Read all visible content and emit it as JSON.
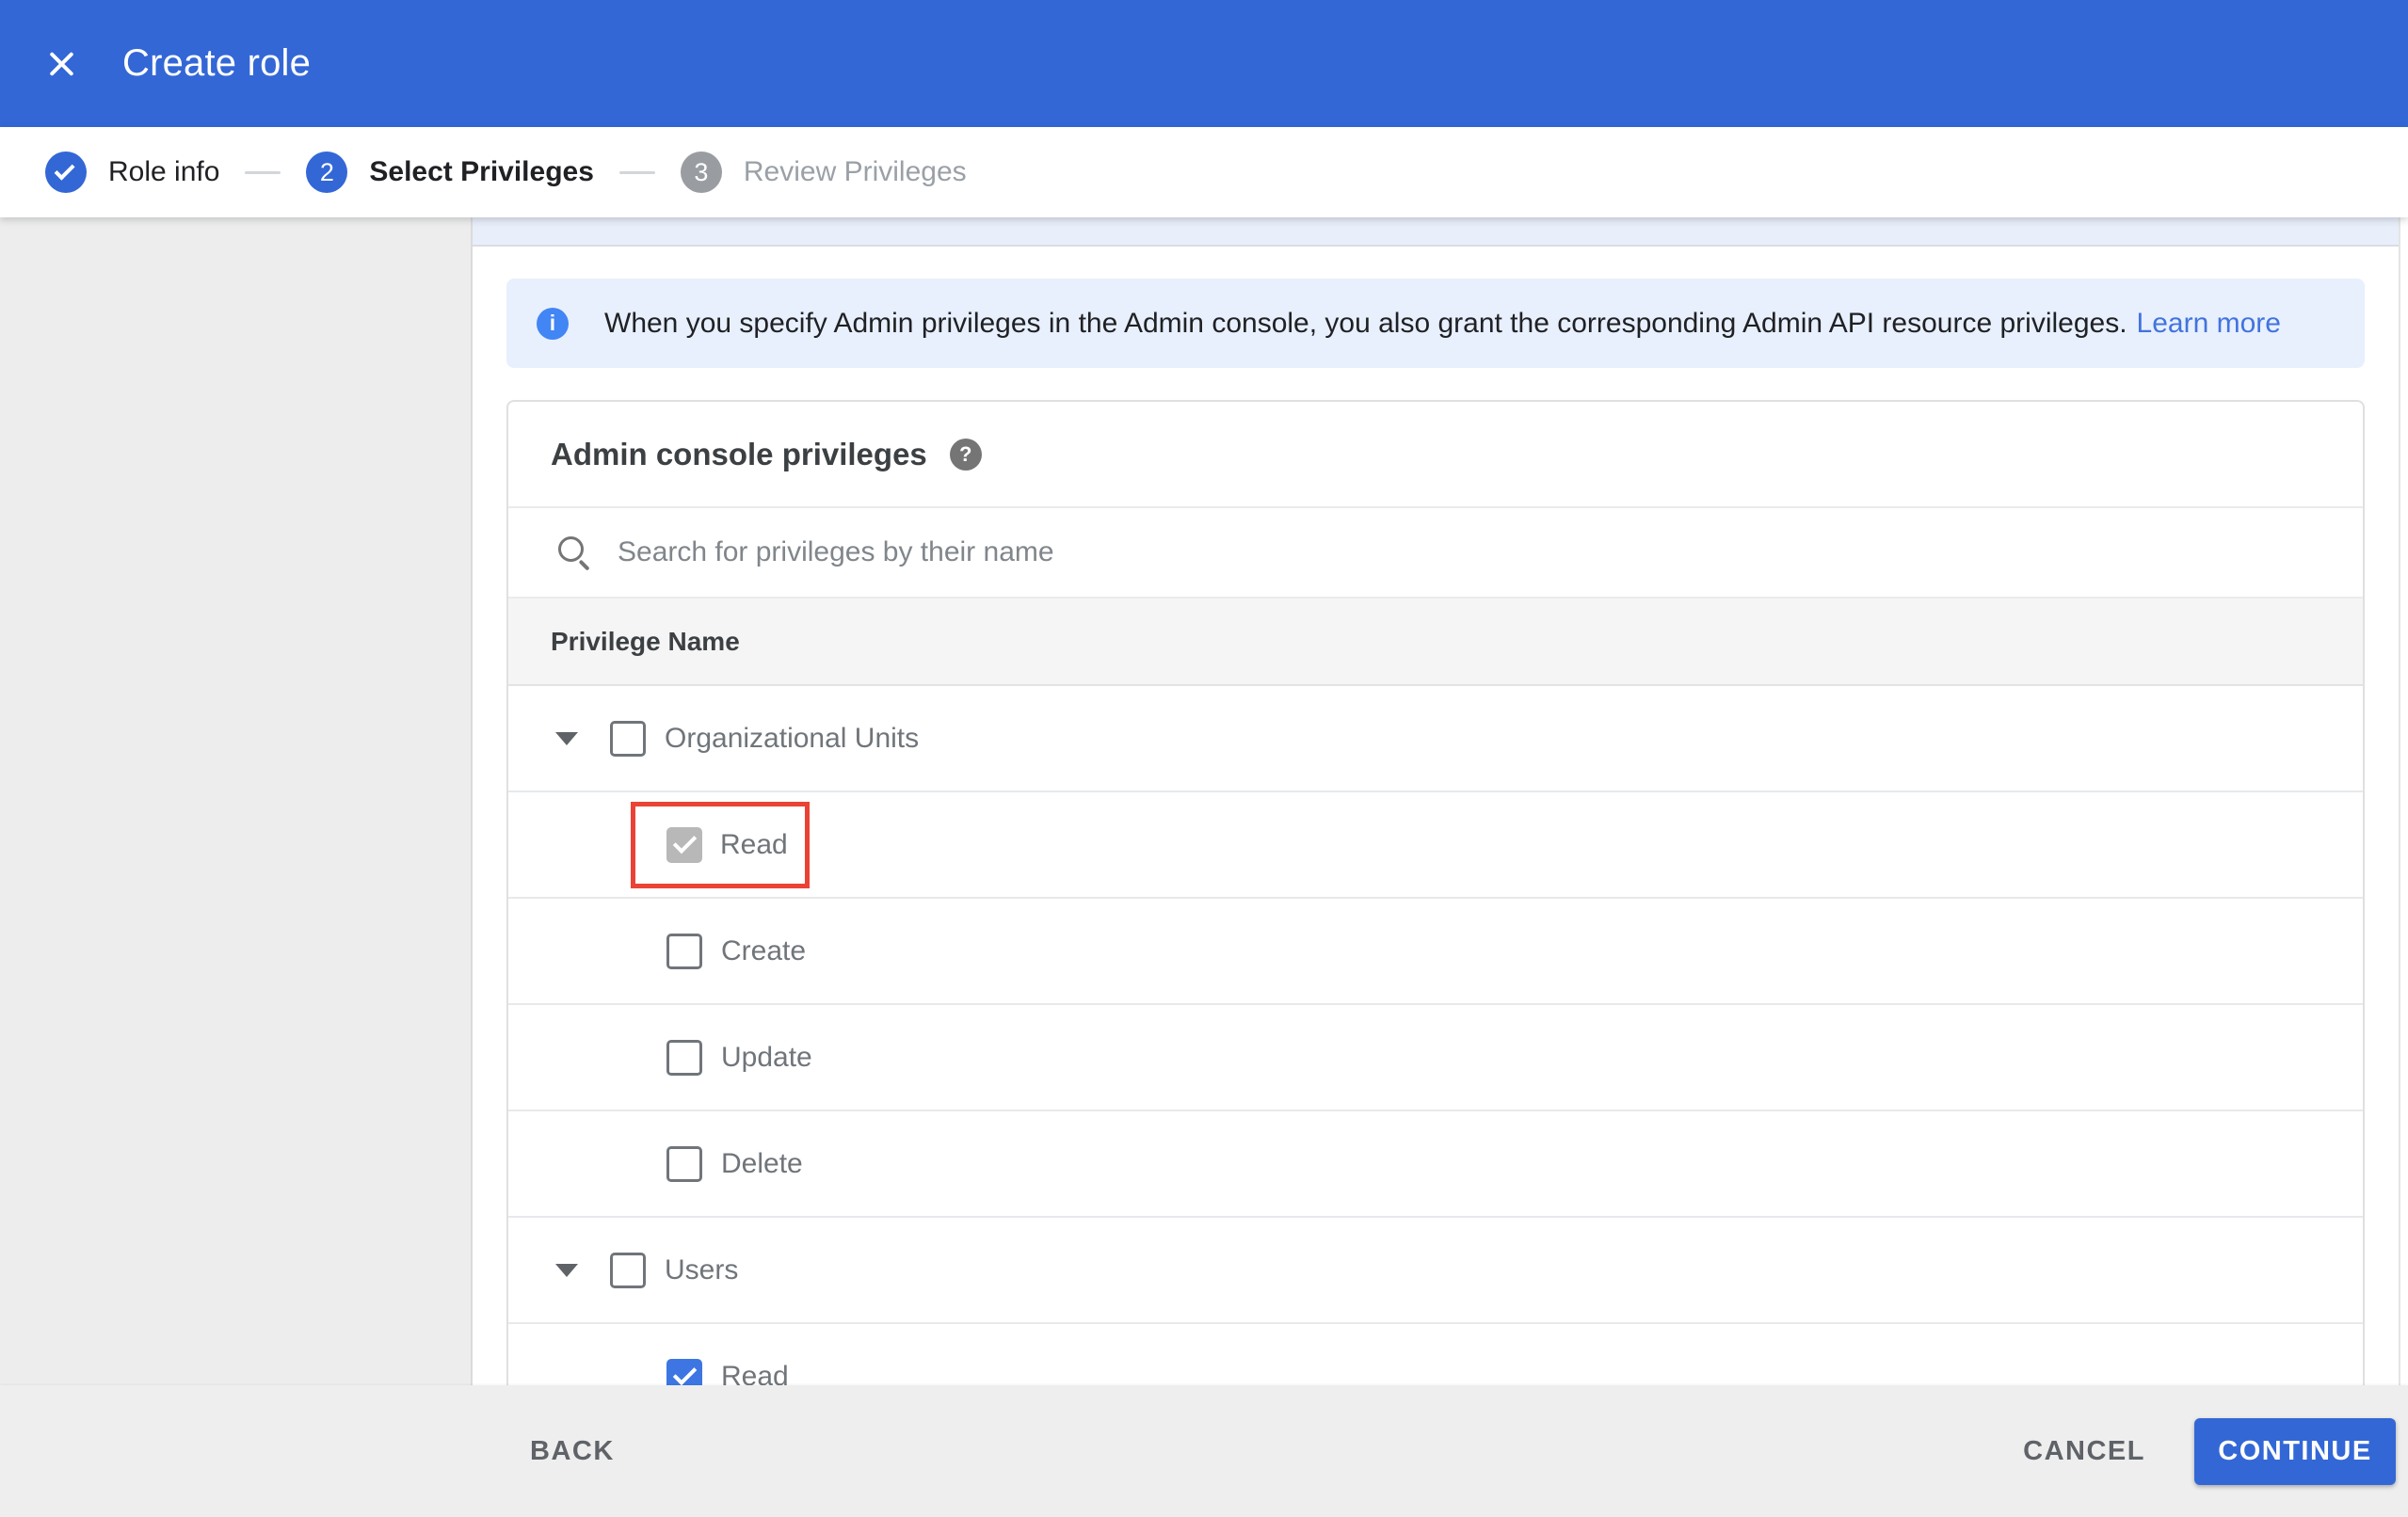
{
  "header": {
    "title": "Create role"
  },
  "stepper": {
    "steps": [
      {
        "label": "Role info",
        "state": "complete"
      },
      {
        "num": "2",
        "label": "Select Privileges",
        "state": "active"
      },
      {
        "num": "3",
        "label": "Review Privileges",
        "state": "upcoming"
      }
    ]
  },
  "banner": {
    "text": "When you specify Admin privileges in the Admin console, you also grant the corresponding Admin API resource privileges.",
    "link_label": "Learn more"
  },
  "privileges_card": {
    "title": "Admin console privileges",
    "search_placeholder": "Search for privileges by their name",
    "column_header": "Privilege Name",
    "rows": [
      {
        "type": "group",
        "label": "Organizational Units",
        "checkbox": "unchecked",
        "expanded": true
      },
      {
        "type": "child",
        "label": "Read",
        "checkbox": "checked-disabled",
        "highlighted": true
      },
      {
        "type": "child",
        "label": "Create",
        "checkbox": "unchecked"
      },
      {
        "type": "child",
        "label": "Update",
        "checkbox": "unchecked"
      },
      {
        "type": "child",
        "label": "Delete",
        "checkbox": "unchecked"
      },
      {
        "type": "group",
        "label": "Users",
        "checkbox": "unchecked",
        "expanded": true
      },
      {
        "type": "child",
        "label": "Read",
        "checkbox": "checked"
      }
    ]
  },
  "footer": {
    "back_label": "BACK",
    "cancel_label": "CANCEL",
    "continue_label": "CONTINUE"
  },
  "colors": {
    "primary_blue": "#3367d6",
    "info_icon_blue": "#4285f4",
    "checkbox_checked_blue": "#3d76e3",
    "banner_bg": "#e8f0fe",
    "highlight_red": "#ea4335"
  }
}
